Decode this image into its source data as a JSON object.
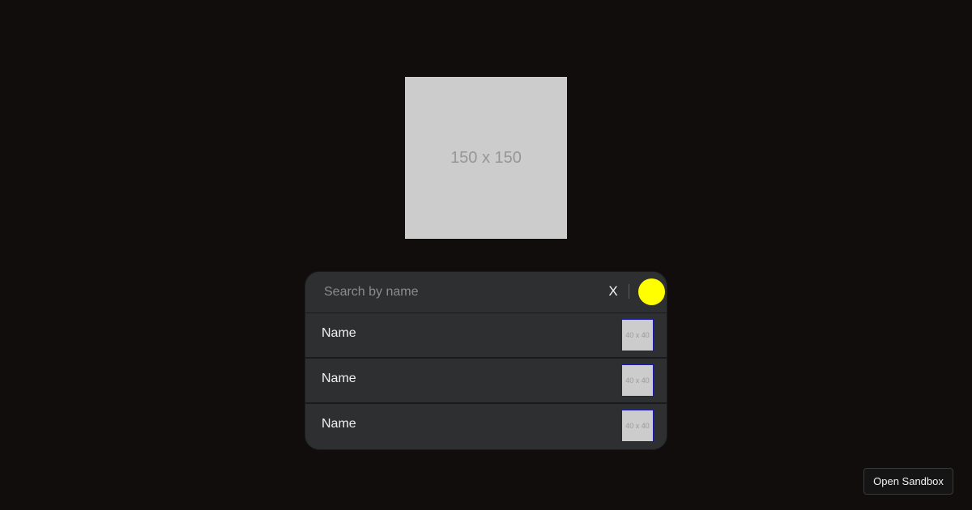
{
  "hero": {
    "placeholder_label": "150 x 150"
  },
  "search": {
    "placeholder": "Search by name",
    "value": "",
    "clear_label": "X",
    "status_color": "#ffff00"
  },
  "results": [
    {
      "name": "Name",
      "thumb_label": "40 x 40"
    },
    {
      "name": "Name",
      "thumb_label": "40 x 40"
    },
    {
      "name": "Name",
      "thumb_label": "40 x 40"
    }
  ],
  "footer": {
    "sandbox_label": "Open Sandbox"
  }
}
